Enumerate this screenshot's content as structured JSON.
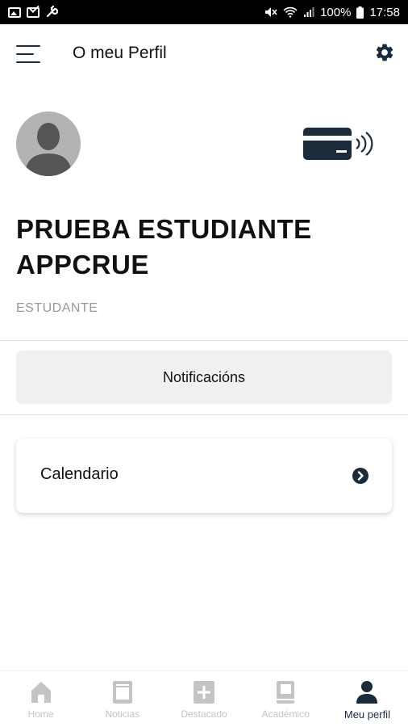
{
  "status_bar": {
    "battery": "100%",
    "time": "17:58"
  },
  "header": {
    "title": "O meu Perfil"
  },
  "profile": {
    "name_line1": "PRUEBA ESTUDIANTE",
    "name_line2": "APPCRUE",
    "role": "ESTUDANTE"
  },
  "actions": {
    "notifications_label": "Notificacións",
    "calendar_label": "Calendario"
  },
  "bottom_nav": {
    "items": [
      {
        "label": "Home",
        "icon": "home-icon",
        "active": false
      },
      {
        "label": "Noticias",
        "icon": "news-icon",
        "active": false
      },
      {
        "label": "Destacado",
        "icon": "plus-icon",
        "active": false
      },
      {
        "label": "Académico",
        "icon": "book-icon",
        "active": false
      },
      {
        "label": "Meu perfil",
        "icon": "person-icon",
        "active": true
      }
    ]
  },
  "colors": {
    "accent": "#1c2b3a",
    "inactive": "#c4c4c4",
    "role_text": "#999999",
    "button_bg": "#f0f0f0"
  }
}
